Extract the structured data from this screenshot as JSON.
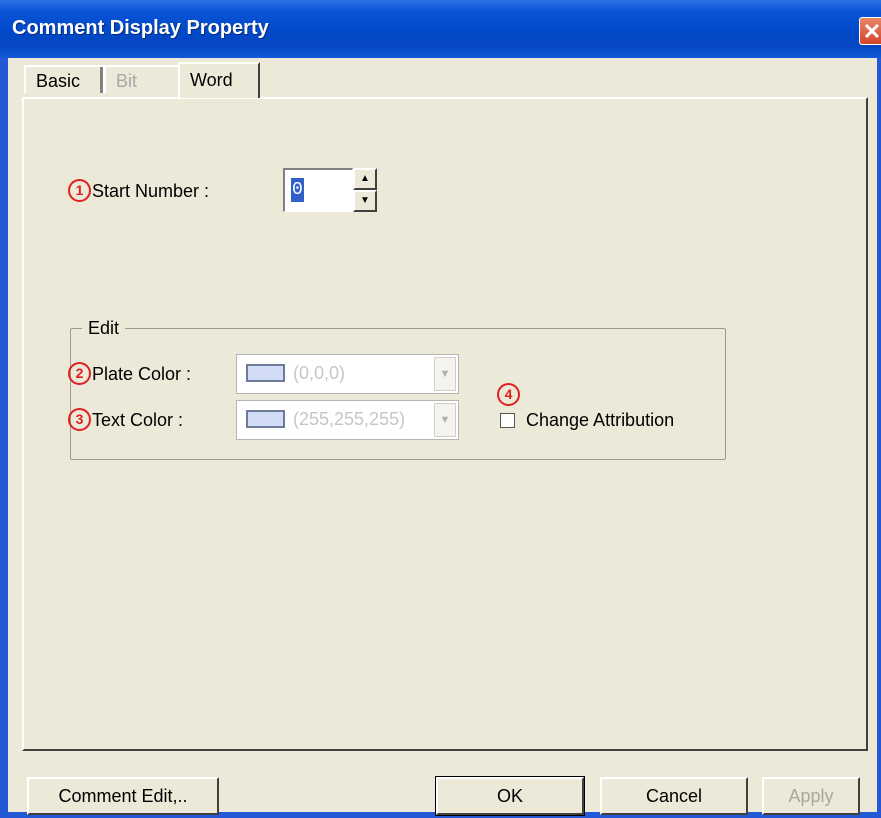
{
  "window": {
    "title": "Comment Display Property",
    "close_glyph": "✕"
  },
  "tabs": [
    {
      "label": "Basic",
      "state": "normal"
    },
    {
      "label": "Bit",
      "state": "disabled"
    },
    {
      "label": "Word",
      "state": "selected"
    }
  ],
  "start_number": {
    "marker": "1",
    "label": "Start Number :",
    "value": "0"
  },
  "edit_group": {
    "title": "Edit",
    "plate_color": {
      "marker": "2",
      "label": "Plate Color :",
      "value": "(0,0,0)",
      "swatch": "#d2ddf5"
    },
    "text_color": {
      "marker": "3",
      "label": "Text Color :",
      "value": "(255,255,255)",
      "swatch": "#d2ddf5"
    },
    "change_attribution": {
      "marker": "4",
      "label": "Change Attribution",
      "checked": false
    }
  },
  "buttons": {
    "comment_edit": "Comment Edit,..",
    "ok": "OK",
    "cancel": "Cancel",
    "apply": "Apply"
  },
  "colors": {
    "title_bar": "#0a53d6",
    "dialog_bg": "#ece9d8",
    "marker": "#e02020",
    "disabled_text": "#aca899"
  }
}
